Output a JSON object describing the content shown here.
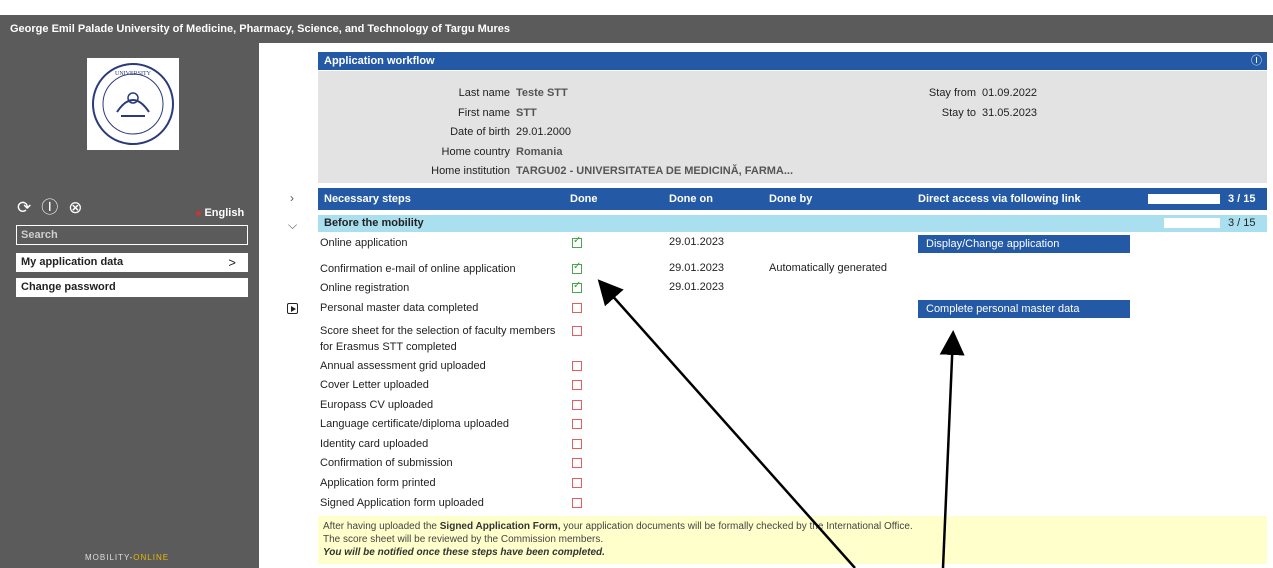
{
  "header": {
    "title": "George Emil Palade University of Medicine, Pharmacy, Science, and Technology of Targu Mures"
  },
  "sidebar": {
    "logo_text": "UNIVERSITY",
    "icons": [
      "refresh-icon",
      "help-icon",
      "close-icon"
    ],
    "language": "English",
    "search_placeholder": "Search",
    "menu": [
      {
        "label": "My application data",
        "chevron": ">"
      },
      {
        "label": "Change password"
      }
    ],
    "footer_brand_a": "MOBILITY-",
    "footer_brand_b": "ONLINE"
  },
  "workflow": {
    "title": "Application workflow",
    "help": "?",
    "fields": {
      "last_name_label": "Last name",
      "last_name": "Teste STT",
      "first_name_label": "First name",
      "first_name": "STT",
      "dob_label": "Date of birth",
      "dob": "29.01.2000",
      "country_label": "Home country",
      "country": "Romania",
      "institution_label": "Home institution",
      "institution": "TARGU02 - UNIVERSITATEA DE MEDICINĂ, FARMA...",
      "stay_from_label": "Stay from",
      "stay_from": "01.09.2022",
      "stay_to_label": "Stay to",
      "stay_to": "31.05.2023"
    }
  },
  "steps_table": {
    "headers": {
      "steps": "Necessary steps",
      "done": "Done",
      "done_on": "Done on",
      "done_by": "Done by",
      "link": "Direct access via following link"
    },
    "progress_text": "3 / 15",
    "progress_fraction": 0.2,
    "group": {
      "label": "Before the mobility",
      "progress_text": "3 / 15"
    },
    "rows": [
      {
        "label": "Online application",
        "done": true,
        "date": "29.01.2023",
        "by": "",
        "link": "Display/Change application"
      },
      {
        "label": "Confirmation e-mail of online application",
        "done": true,
        "date": "29.01.2023",
        "by": "Automatically generated",
        "link": ""
      },
      {
        "label": "Online registration",
        "done": true,
        "date": "29.01.2023",
        "by": "",
        "link": ""
      },
      {
        "label": "Personal master data completed",
        "done": false,
        "date": "",
        "by": "",
        "link": "Complete personal master data"
      },
      {
        "label": "Score sheet for the selection of faculty members for Erasmus STT completed",
        "done": false,
        "date": "",
        "by": "",
        "link": ""
      },
      {
        "label": "Annual assessment grid uploaded",
        "done": false,
        "date": "",
        "by": "",
        "link": ""
      },
      {
        "label": "Cover Letter uploaded",
        "done": false,
        "date": "",
        "by": "",
        "link": ""
      },
      {
        "label": "Europass CV uploaded",
        "done": false,
        "date": "",
        "by": "",
        "link": ""
      },
      {
        "label": "Language certificate/diploma uploaded",
        "done": false,
        "date": "",
        "by": "",
        "link": ""
      },
      {
        "label": "Identity card uploaded",
        "done": false,
        "date": "",
        "by": "",
        "link": ""
      },
      {
        "label": "Confirmation of submission",
        "done": false,
        "date": "",
        "by": "",
        "link": ""
      },
      {
        "label": "Application form printed",
        "done": false,
        "date": "",
        "by": "",
        "link": ""
      },
      {
        "label": "Signed Application form uploaded",
        "done": false,
        "date": "",
        "by": "",
        "link": ""
      }
    ]
  },
  "note": {
    "line1_a": "After having uploaded the ",
    "line1_b": "Signed Application Form,",
    "line1_c": " your application documents will be formally checked by the International Office.",
    "line2": "The score sheet will be reviewed by the Commission members.",
    "line3": "You will be notified once these steps have been completed."
  },
  "colors": {
    "primary": "#2459a6",
    "sidebar": "#5b5b5b",
    "group": "#aadfef",
    "note": "#ffffcc"
  }
}
